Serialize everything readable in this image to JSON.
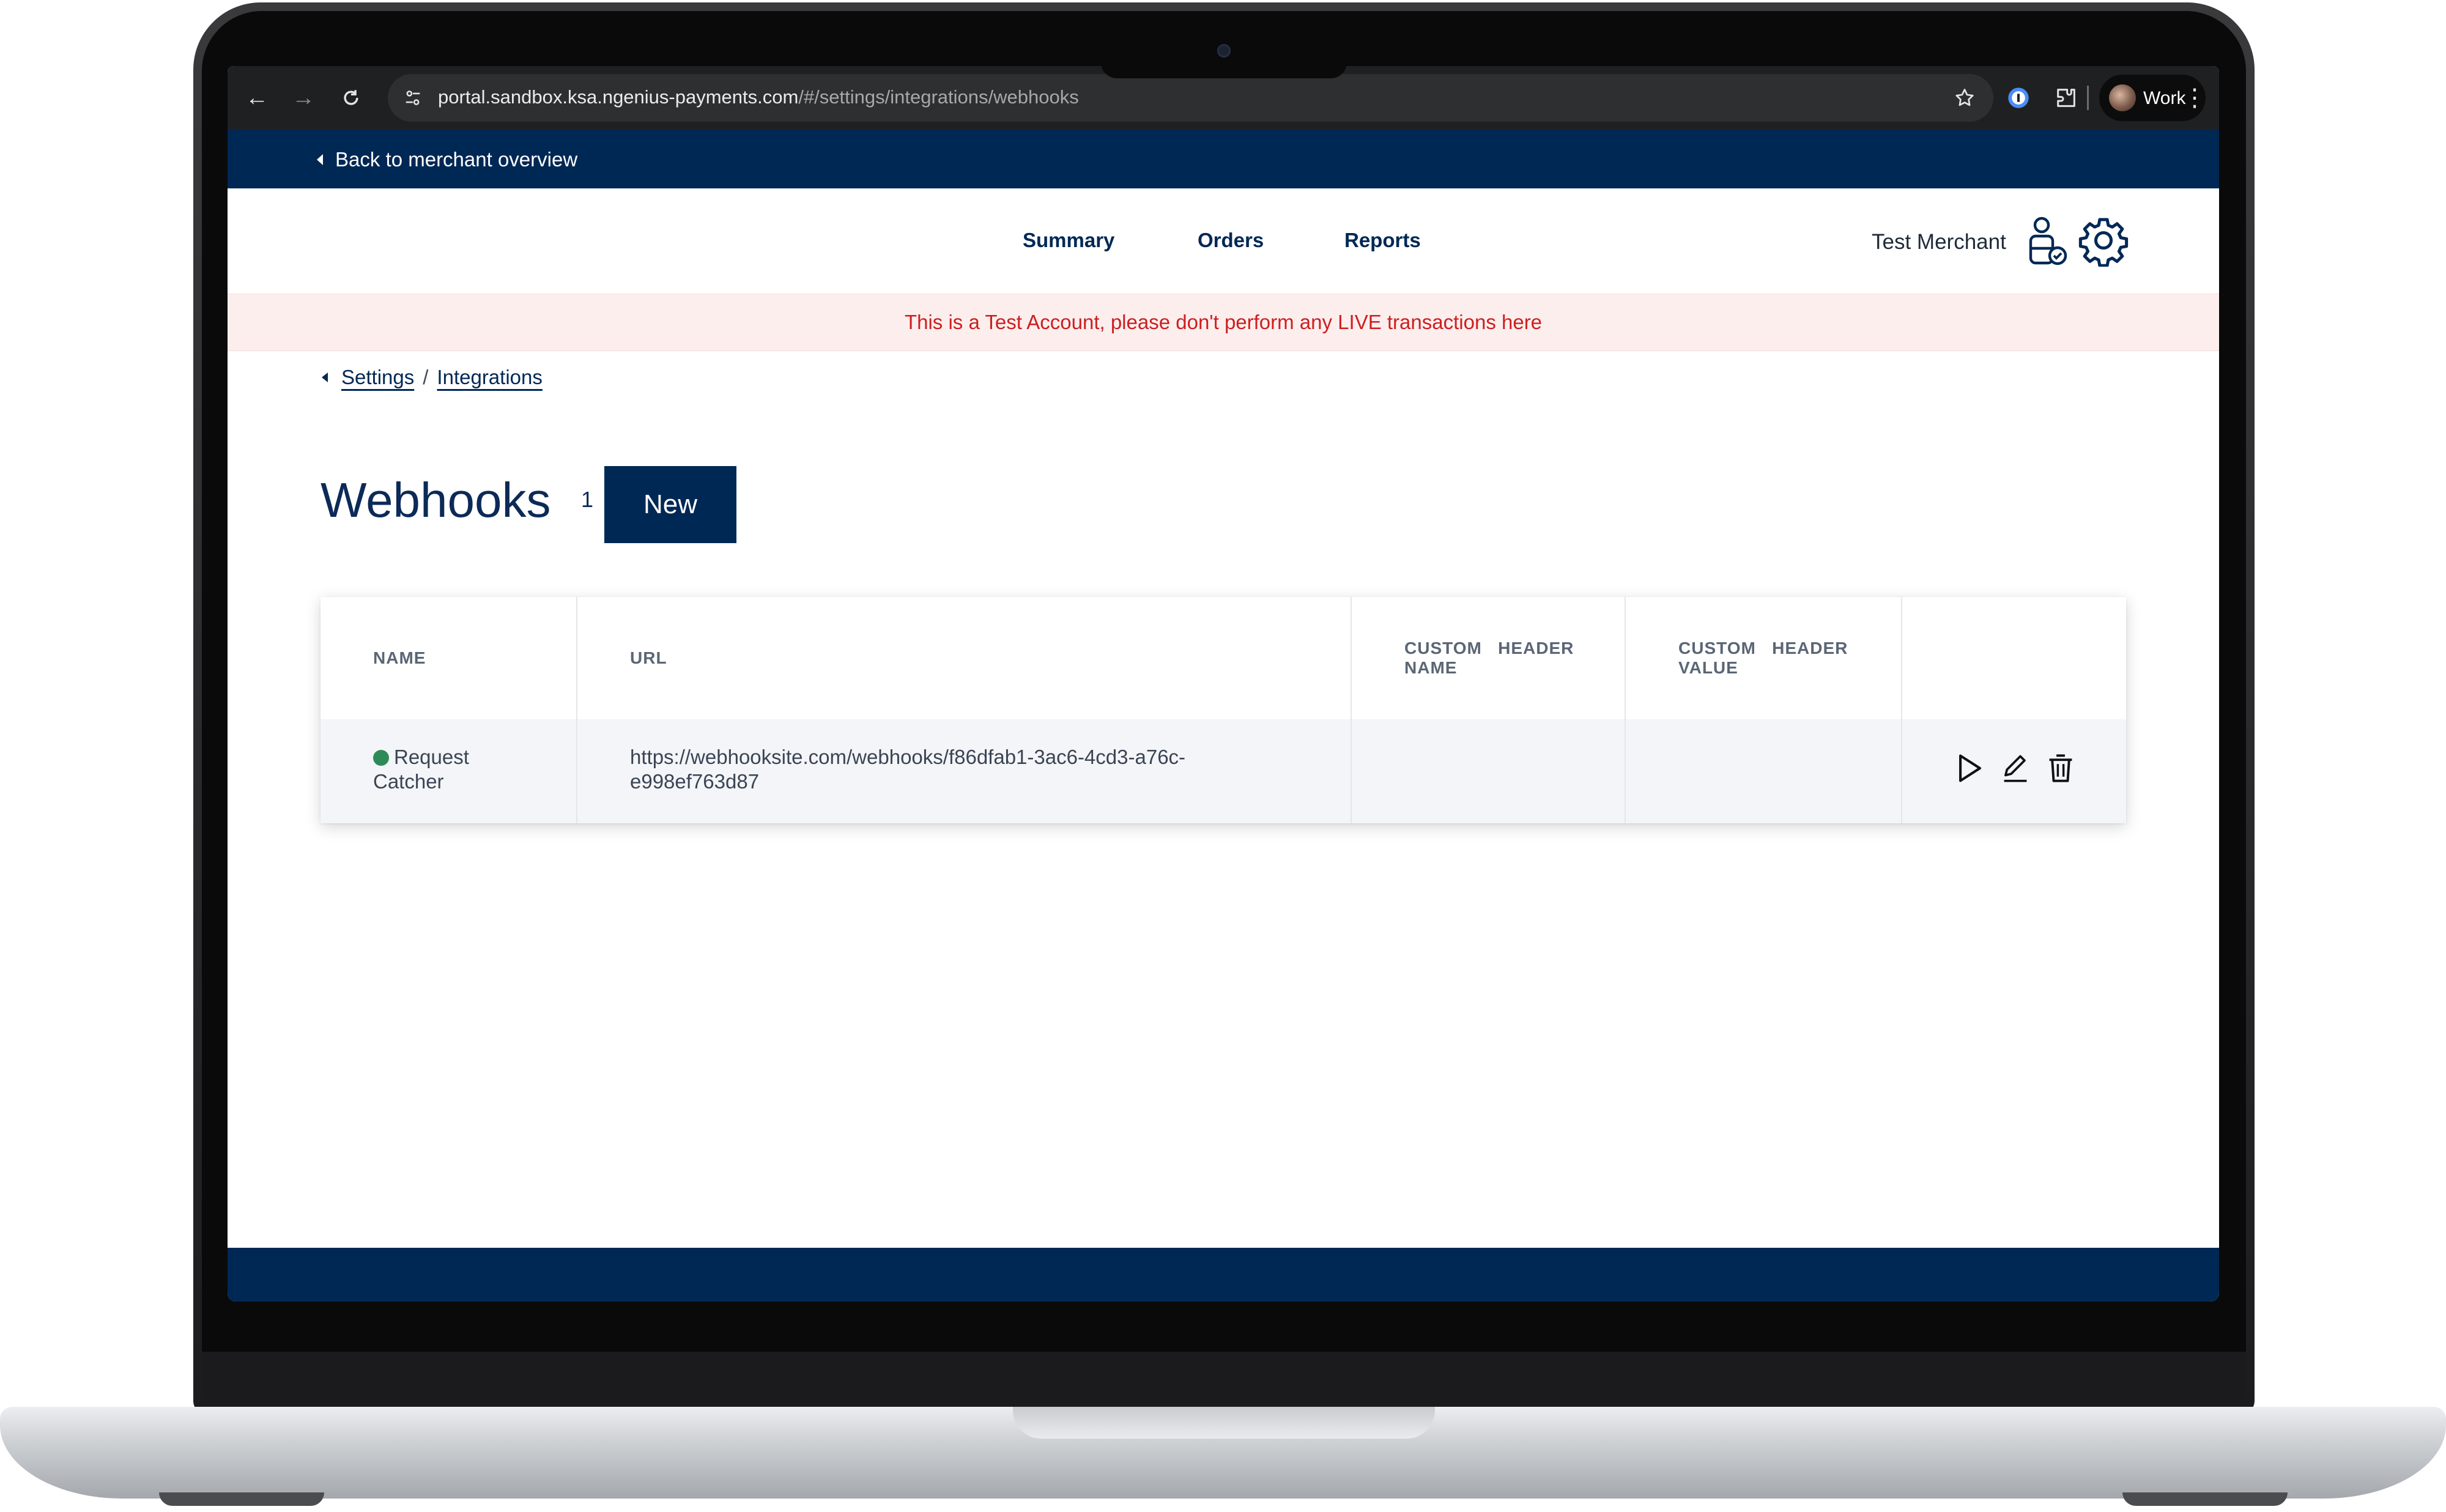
{
  "browser": {
    "url_host": "portal.sandbox.ksa.ngenius-payments.com",
    "url_path": "/#/settings/integrations/webhooks",
    "profile_label": "Work"
  },
  "topbar": {
    "back_label": "Back to merchant overview"
  },
  "nav": {
    "items": [
      {
        "label": "Summary"
      },
      {
        "label": "Orders"
      },
      {
        "label": "Reports"
      }
    ],
    "merchant_name": "Test Merchant"
  },
  "warning": {
    "text": "This is a Test Account, please don't perform any LIVE transactions here"
  },
  "breadcrumb": {
    "items": [
      {
        "label": "Settings"
      },
      {
        "label": "Integrations"
      }
    ],
    "separator": "/"
  },
  "page": {
    "title": "Webhooks",
    "count": "1",
    "new_label": "New"
  },
  "table": {
    "headers": {
      "name": "NAME",
      "url": "URL",
      "custom_header_name_1": "CUSTOM   HEADER",
      "custom_header_name_2": "NAME",
      "custom_header_value_1": "CUSTOM   HEADER",
      "custom_header_value_2": "VALUE"
    },
    "rows": [
      {
        "status_color": "#2e8b57",
        "name_line1": "Request",
        "name_line2": "Catcher",
        "url_line1": "https://webhooksite.com/webhooks/f86dfab1-3ac6-4cd3-a76c-",
        "url_line2": "e998ef763d87",
        "custom_header_name": "",
        "custom_header_value": ""
      }
    ]
  },
  "colors": {
    "brand_navy": "#002855",
    "warning_red": "#cc1f1f",
    "warning_bg": "#fdeeee",
    "active_green": "#2e8b57"
  },
  "icons": [
    "back-arrow-icon",
    "forward-arrow-icon",
    "reload-icon",
    "site-info-icon",
    "bookmark-star-icon",
    "password-manager-icon",
    "extensions-icon",
    "kebab-menu-icon",
    "merchant-user-icon",
    "gear-icon",
    "play-icon",
    "pencil-icon",
    "trash-icon"
  ]
}
